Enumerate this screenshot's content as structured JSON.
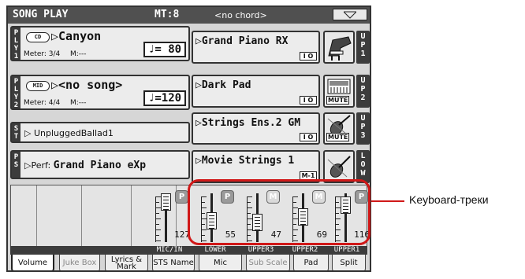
{
  "title_bar": {
    "title": "SONG PLAY",
    "mt": "MT:8",
    "chord": "<no chord>"
  },
  "player1": {
    "tag": "P\nL\nY\n1",
    "badge": "CD",
    "name": "▷Canyon",
    "meter": "Meter: 3/4",
    "measure": "M:---",
    "tempo": "♩= 80"
  },
  "player2": {
    "tag": "P\nL\nY\n2",
    "badge": "MID",
    "name": "▷<no song>",
    "meter": "Meter: 4/4",
    "measure": "M:---",
    "tempo": "♩=120"
  },
  "style": {
    "tag": "S\nT",
    "name": "▷ UnpluggedBallad1"
  },
  "performance": {
    "tag": "P\nS",
    "prefix": "▷Perf:",
    "name": "Grand Piano eXp"
  },
  "tracks": [
    {
      "name": "▷Grand Piano RX",
      "bank": "I O",
      "side": "U\nP\n1",
      "icon": "piano-icon",
      "mute": ""
    },
    {
      "name": "▷Dark Pad",
      "bank": "I O",
      "side": "U\nP\n2",
      "icon": "synth-icon",
      "mute": "MUTE"
    },
    {
      "name": "▷Strings Ens.2 GM",
      "bank": "I O",
      "side": "U\nP\n3",
      "icon": "violin-icon",
      "mute": "MUTE"
    },
    {
      "name": "▷Movie Strings 1",
      "bank": "M-1",
      "side": "L\nO\nW",
      "icon": "violin-icon",
      "mute": ""
    }
  ],
  "mixer": {
    "channels": [
      {
        "label": "MIC/IN",
        "value": "127",
        "button": "P",
        "level": 1.0
      },
      {
        "label": "LOWER",
        "value": "55",
        "button": "P",
        "level": 0.43
      },
      {
        "label": "UPPER3",
        "value": "47",
        "button": "M",
        "level": 0.37
      },
      {
        "label": "UPPER2",
        "value": "69",
        "button": "M",
        "level": 0.54
      },
      {
        "label": "UPPER1",
        "value": "116",
        "button": "P",
        "level": 0.91
      }
    ]
  },
  "tabs": [
    "Volume",
    "Juke Box",
    "Lyrics & Mark",
    "STS Name",
    "Mic",
    "Sub Scale",
    "Pad",
    "Split"
  ],
  "annotation": {
    "text": "Keyboard-треки",
    "color": "#d01818"
  }
}
